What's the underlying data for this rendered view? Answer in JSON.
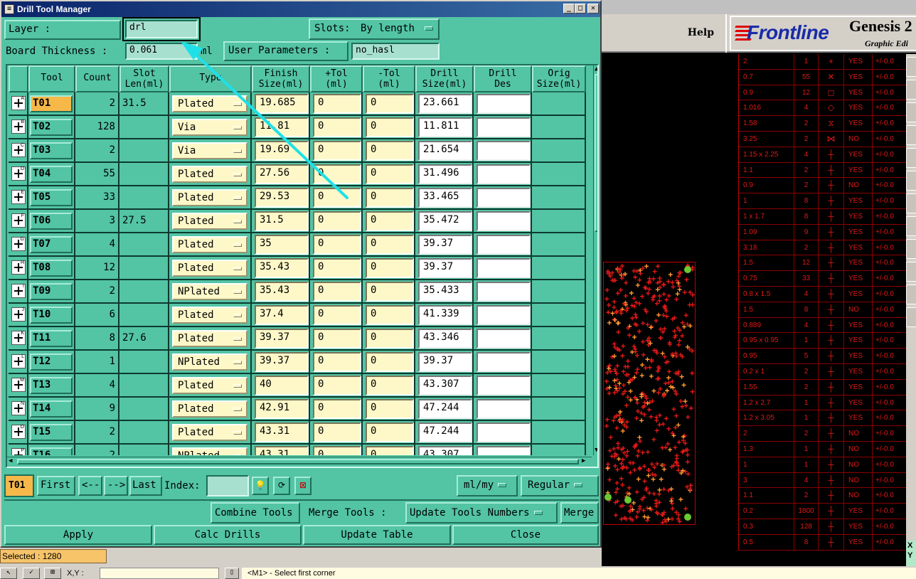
{
  "genesis": {
    "help_label": "Help",
    "logo_brand": "Frontline",
    "logo_product": "Genesis 2",
    "logo_edition": "Graphic Edi",
    "xy_label_x": "X",
    "xy_label_y": "Y",
    "drill_rows": [
      {
        "size": "2",
        "count": "1",
        "sym": "+",
        "plated": "YES",
        "tol": "+/-0.0"
      },
      {
        "size": "0.7",
        "count": "55",
        "sym": "✕",
        "plated": "YES",
        "tol": "+/-0.0"
      },
      {
        "size": "0.9",
        "count": "12",
        "sym": "◻",
        "plated": "YES",
        "tol": "+/-0.0"
      },
      {
        "size": "1.016",
        "count": "4",
        "sym": "◇",
        "plated": "YES",
        "tol": "+/-0.0"
      },
      {
        "size": "1.58",
        "count": "2",
        "sym": "⧖",
        "plated": "YES",
        "tol": "+/-0.0"
      },
      {
        "size": "3.25",
        "count": "2",
        "sym": "⋈",
        "plated": "NO",
        "tol": "+/-0.0"
      },
      {
        "size": "1.15 x 2.25",
        "count": "4",
        "sym": "┼",
        "plated": "YES",
        "tol": "+/-0.0"
      },
      {
        "size": "1.1",
        "count": "2",
        "sym": "┼",
        "plated": "YES",
        "tol": "+/-0.0"
      },
      {
        "size": "0.9",
        "count": "2",
        "sym": "┼",
        "plated": "NO",
        "tol": "+/-0.0"
      },
      {
        "size": "1",
        "count": "8",
        "sym": "┼",
        "plated": "YES",
        "tol": "+/-0.0"
      },
      {
        "size": "1 x 1.7",
        "count": "8",
        "sym": "┼",
        "plated": "YES",
        "tol": "+/-0.0"
      },
      {
        "size": "1.09",
        "count": "9",
        "sym": "┼",
        "plated": "YES",
        "tol": "+/-0.0"
      },
      {
        "size": "3.18",
        "count": "2",
        "sym": "┼",
        "plated": "YES",
        "tol": "+/-0.0"
      },
      {
        "size": "1.5",
        "count": "12",
        "sym": "┼",
        "plated": "YES",
        "tol": "+/-0.0"
      },
      {
        "size": "0.75",
        "count": "33",
        "sym": "┼",
        "plated": "YES",
        "tol": "+/-0.0"
      },
      {
        "size": "0.8 x 1.5",
        "count": "4",
        "sym": "┼",
        "plated": "YES",
        "tol": "+/-0.0"
      },
      {
        "size": "1.5",
        "count": "8",
        "sym": "┼",
        "plated": "NO",
        "tol": "+/-0.0"
      },
      {
        "size": "0.889",
        "count": "4",
        "sym": "┼",
        "plated": "YES",
        "tol": "+/-0.0"
      },
      {
        "size": "0.95 x 0.95",
        "count": "1",
        "sym": "┼",
        "plated": "YES",
        "tol": "+/-0.0"
      },
      {
        "size": "0.95",
        "count": "5",
        "sym": "┼",
        "plated": "YES",
        "tol": "+/-0.0"
      },
      {
        "size": "0.2 x 1",
        "count": "2",
        "sym": "┼",
        "plated": "YES",
        "tol": "+/-0.0"
      },
      {
        "size": "1.55",
        "count": "2",
        "sym": "┼",
        "plated": "YES",
        "tol": "+/-0.0"
      },
      {
        "size": "1.2 x 2.7",
        "count": "1",
        "sym": "┼",
        "plated": "YES",
        "tol": "+/-0.0"
      },
      {
        "size": "1.2 x 3.05",
        "count": "1",
        "sym": "┼",
        "plated": "YES",
        "tol": "+/-0.0"
      },
      {
        "size": "2",
        "count": "2",
        "sym": "┼",
        "plated": "NO",
        "tol": "+/-0.0"
      },
      {
        "size": "1.3",
        "count": "1",
        "sym": "┼",
        "plated": "NO",
        "tol": "+/-0.0"
      },
      {
        "size": "1",
        "count": "1",
        "sym": "┼",
        "plated": "NO",
        "tol": "+/-0.0"
      },
      {
        "size": "3",
        "count": "4",
        "sym": "┼",
        "plated": "NO",
        "tol": "+/-0.0"
      },
      {
        "size": "1.1",
        "count": "2",
        "sym": "┼",
        "plated": "NO",
        "tol": "+/-0.0"
      },
      {
        "size": "0.2",
        "count": "1800",
        "sym": "┼",
        "plated": "YES",
        "tol": "+/-0.0"
      },
      {
        "size": "0.3",
        "count": "128",
        "sym": "┼",
        "plated": "YES",
        "tol": "+/-0.0"
      },
      {
        "size": "0.5",
        "count": "8",
        "sym": "┼",
        "plated": "YES",
        "tol": "+/-0.0"
      }
    ]
  },
  "window": {
    "title": "Drill Tool Manager",
    "minimize": "_",
    "maximize": "□",
    "close": "✕"
  },
  "top": {
    "layer_label": "Layer           :",
    "layer_value": "drl",
    "slots_label": "Slots:",
    "slots_value": "By length",
    "board_thickness_label": "Board Thickness :",
    "board_thickness_value": "0.061",
    "board_thickness_unit": "ml",
    "user_params_label": "User Parameters :",
    "user_params_value": "no_hasl"
  },
  "columns": [
    "Tool",
    "Count",
    "Slot\nLen(ml)",
    "Type",
    "Finish\nSize(ml)",
    "+Tol\n(ml)",
    "-Tol\n(ml)",
    "Drill\nSize(ml)",
    "Drill\nDes",
    "Orig\nSize(ml)"
  ],
  "rows": [
    {
      "sup": "A",
      "tool": "T01",
      "count": "2",
      "slot": "31.5",
      "type": "Plated",
      "finish": "19.685",
      "ptol": "0",
      "mtol": "0",
      "drill": "23.661",
      "des": ""
    },
    {
      "sup": "B",
      "tool": "T02",
      "count": "128",
      "slot": "",
      "type": "Via",
      "finish": "11.81",
      "ptol": "0",
      "mtol": "0",
      "drill": "11.811",
      "des": ""
    },
    {
      "sup": "C",
      "tool": "T03",
      "count": "2",
      "slot": "",
      "type": "Via",
      "finish": "19.69",
      "ptol": "0",
      "mtol": "0",
      "drill": "21.654",
      "des": ""
    },
    {
      "sup": "D",
      "tool": "T04",
      "count": "55",
      "slot": "",
      "type": "Plated",
      "finish": "27.56",
      "ptol": "0",
      "mtol": "0",
      "drill": "31.496",
      "des": ""
    },
    {
      "sup": "E",
      "tool": "T05",
      "count": "33",
      "slot": "",
      "type": "Plated",
      "finish": "29.53",
      "ptol": "0",
      "mtol": "0",
      "drill": "33.465",
      "des": ""
    },
    {
      "sup": "F",
      "tool": "T06",
      "count": "3",
      "slot": "27.5",
      "type": "Plated",
      "finish": "31.5",
      "ptol": "0",
      "mtol": "0",
      "drill": "35.472",
      "des": ""
    },
    {
      "sup": "G",
      "tool": "T07",
      "count": "4",
      "slot": "",
      "type": "Plated",
      "finish": "35",
      "ptol": "0",
      "mtol": "0",
      "drill": "39.37",
      "des": ""
    },
    {
      "sup": "H",
      "tool": "T08",
      "count": "12",
      "slot": "",
      "type": "Plated",
      "finish": "35.43",
      "ptol": "0",
      "mtol": "0",
      "drill": "39.37",
      "des": ""
    },
    {
      "sup": "I",
      "tool": "T09",
      "count": "2",
      "slot": "",
      "type": "NPlated",
      "finish": "35.43",
      "ptol": "0",
      "mtol": "0",
      "drill": "35.433",
      "des": ""
    },
    {
      "sup": "J",
      "tool": "T10",
      "count": "6",
      "slot": "",
      "type": "Plated",
      "finish": "37.4",
      "ptol": "0",
      "mtol": "0",
      "drill": "41.339",
      "des": ""
    },
    {
      "sup": "K",
      "tool": "T11",
      "count": "8",
      "slot": "27.6",
      "type": "Plated",
      "finish": "39.37",
      "ptol": "0",
      "mtol": "0",
      "drill": "43.346",
      "des": ""
    },
    {
      "sup": "L",
      "tool": "T12",
      "count": "1",
      "slot": "",
      "type": "NPlated",
      "finish": "39.37",
      "ptol": "0",
      "mtol": "0",
      "drill": "39.37",
      "des": ""
    },
    {
      "sup": "M",
      "tool": "T13",
      "count": "4",
      "slot": "",
      "type": "Plated",
      "finish": "40",
      "ptol": "0",
      "mtol": "0",
      "drill": "43.307",
      "des": ""
    },
    {
      "sup": "N",
      "tool": "T14",
      "count": "9",
      "slot": "",
      "type": "Plated",
      "finish": "42.91",
      "ptol": "0",
      "mtol": "0",
      "drill": "47.244",
      "des": ""
    },
    {
      "sup": "O",
      "tool": "T15",
      "count": "2",
      "slot": "",
      "type": "Plated",
      "finish": "43.31",
      "ptol": "0",
      "mtol": "0",
      "drill": "47.244",
      "des": ""
    },
    {
      "sup": "P",
      "tool": "T16",
      "count": "2",
      "slot": "",
      "type": "NPlated",
      "finish": "43.31",
      "ptol": "0",
      "mtol": "0",
      "drill": "43.307",
      "des": ""
    }
  ],
  "nav": {
    "current_tool": "T01",
    "first": "First",
    "prev": "<--",
    "next": "-->",
    "last": "Last",
    "index_label": "Index:",
    "index_value": "",
    "units": "ml/my",
    "mode": "Regular"
  },
  "actions": {
    "combine": "Combine Tools",
    "merge_label": "Merge Tools :",
    "merge_mode": "Update Tools Numbers",
    "merge": "Merge",
    "apply": "Apply",
    "calc": "Calc Drills",
    "update_table": "Update Table",
    "close": "Close"
  },
  "status": {
    "selected": "Selected : 1280",
    "xy_prompt": "X,Y :",
    "message": "<M1> - Select first corner"
  },
  "colors": {
    "dialog_bg": "#53c4a4",
    "highlight": "#f7b84a",
    "field_yellow": "#fef8c8",
    "pcb_red": "#e01818",
    "annotation_arrow": "#1ee0e8"
  }
}
